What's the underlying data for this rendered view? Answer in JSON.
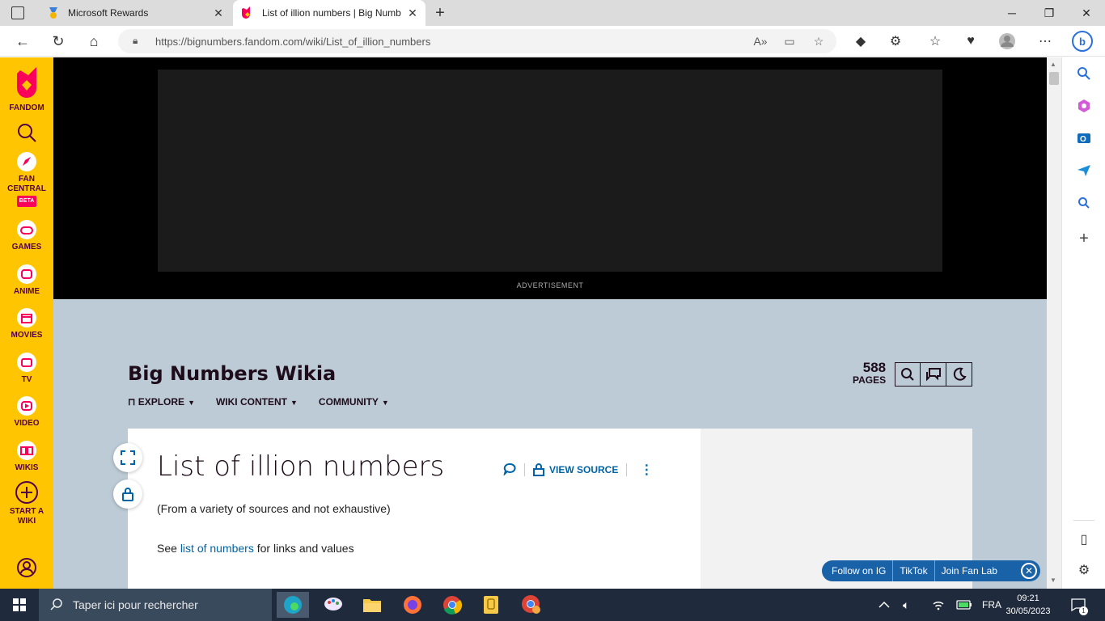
{
  "browser": {
    "tabs": [
      {
        "title": "Microsoft Rewards",
        "active": false,
        "icon": "rewards-medal-icon"
      },
      {
        "title": "List of illion numbers | Big Numb",
        "active": true,
        "icon": "fandom-flame-icon"
      }
    ],
    "new_tab_icon": "plus-icon",
    "window_controls": {
      "minimize": "─",
      "restore": "❐",
      "close": "✕"
    },
    "url": "https://bignumbers.fandom.com/wiki/List_of_illion_numbers"
  },
  "fandom_sidebar": {
    "logo_label": "FANDOM",
    "items": [
      {
        "label": "FAN",
        "label2": "CENTRAL",
        "badge": "BETA",
        "icon": "rocket-icon"
      },
      {
        "label": "GAMES",
        "icon": "controller-icon"
      },
      {
        "label": "ANIME",
        "icon": "anime-face-icon"
      },
      {
        "label": "MOVIES",
        "icon": "clapper-icon"
      },
      {
        "label": "TV",
        "icon": "tv-icon"
      },
      {
        "label": "VIDEO",
        "icon": "play-icon"
      },
      {
        "label": "WIKIS",
        "icon": "book-icon"
      },
      {
        "label": "START A",
        "label2": "WIKI",
        "icon": "plus-circle-icon"
      }
    ]
  },
  "ad": {
    "label": "ADVERTISEMENT"
  },
  "wiki": {
    "name": "Big Numbers Wikia",
    "nav": [
      "EXPLORE",
      "WIKI CONTENT",
      "COMMUNITY"
    ],
    "pages_count": "588",
    "pages_label": "PAGES"
  },
  "article": {
    "title": "List of illion numbers",
    "view_source": "VIEW SOURCE",
    "intro": "(From a variety of sources and not exhaustive)",
    "see_prefix": "See ",
    "see_link": "list of numbers",
    "see_suffix": " for links and values"
  },
  "follow_bar": {
    "items": [
      "Follow on IG",
      "TikTok",
      "Join Fan Lab"
    ]
  },
  "taskbar": {
    "search_placeholder": "Taper ici pour rechercher",
    "lang": "FRA",
    "time": "09:21",
    "date": "30/05/2023",
    "notif_count": "1"
  },
  "colors": {
    "fandom_yellow": "#ffc500",
    "fandom_pink": "#fa005a",
    "link_blue": "#0064a6",
    "wiki_bg": "#bccbd6"
  }
}
